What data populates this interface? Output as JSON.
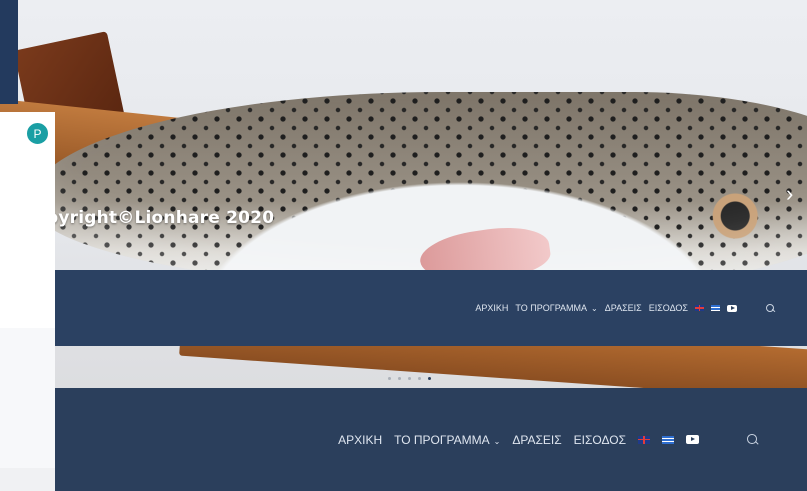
{
  "hero": {
    "copyright_text": "pyright©Lionhare 2020",
    "next_arrow": "›",
    "slider_dots": 5,
    "active_dot": 5
  },
  "nav": {
    "home": "ΑΡΧΙΚΗ",
    "program": "ΤΟ ΠΡΟΓΡΑΜΜΑ",
    "program_chevron": "⌄",
    "actions": "ΔΡΑΣΕΙΣ",
    "login": "ΕΙΣΟΔΟΣ",
    "icons": [
      "flag-uk-icon",
      "flag-gr-icon",
      "youtube-icon",
      "search-icon"
    ]
  },
  "panel": {
    "avatar_letter": "P"
  },
  "colors": {
    "nav_bg": "#2b4162",
    "nav_bg_dark": "#2b3f5c",
    "avatar": "#1a9fa4"
  }
}
